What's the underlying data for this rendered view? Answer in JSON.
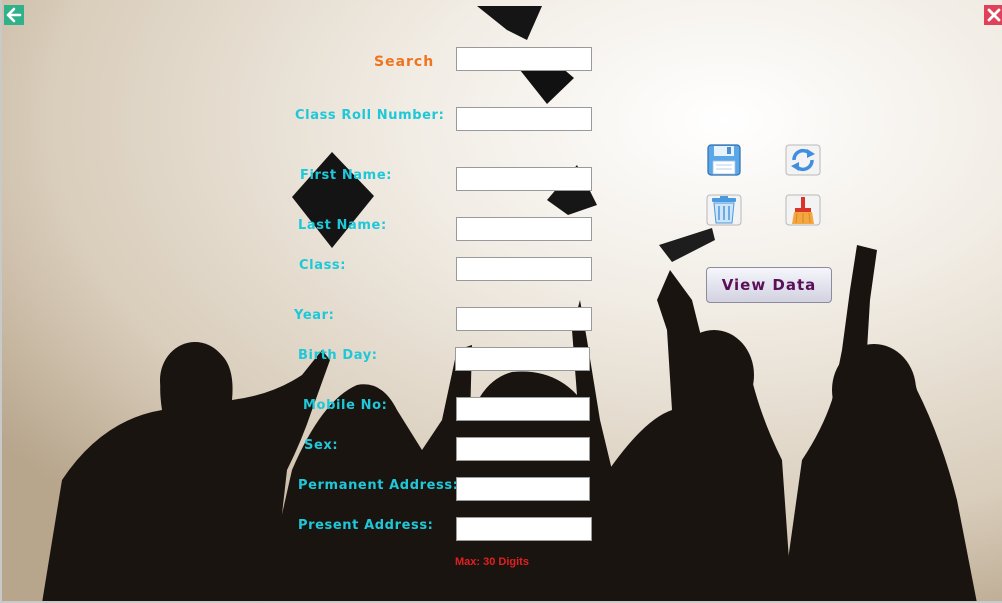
{
  "form": {
    "search_label": "Search",
    "fields": [
      {
        "label": "Class Roll Number:",
        "value": ""
      },
      {
        "label": "First Name:",
        "value": ""
      },
      {
        "label": "Last Name:",
        "value": ""
      },
      {
        "label": "Class:",
        "value": ""
      },
      {
        "label": "Year:",
        "value": ""
      },
      {
        "label": "Birth Day:",
        "value": ""
      },
      {
        "label": "Mobile No:",
        "value": ""
      },
      {
        "label": "Sex:",
        "value": ""
      },
      {
        "label": "Permanent Address:",
        "value": ""
      },
      {
        "label": "Present Address:",
        "value": ""
      }
    ],
    "search_value": "",
    "max_hint": "Max: 30 Digits"
  },
  "actions": {
    "save_icon": "floppy-disk-icon",
    "refresh_icon": "refresh-icon",
    "delete_icon": "trash-icon",
    "clear_icon": "broom-icon",
    "view_data_label": "View Data"
  },
  "window": {
    "back_icon": "back-arrow-icon",
    "close_icon": "close-icon"
  },
  "colors": {
    "label": "#1ec8d8",
    "search_label": "#f0731e",
    "view_data_text": "#5a0f57",
    "hint": "#e02020"
  }
}
